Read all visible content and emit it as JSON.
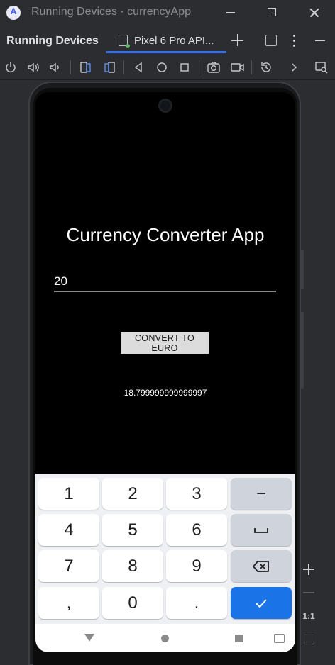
{
  "window": {
    "title": "Running Devices - currencyApp"
  },
  "tool_window": {
    "title": "Running Devices",
    "device_tab": "Pixel 6 Pro API..."
  },
  "toolbar": {
    "icons": [
      "power-icon",
      "volume-up-icon",
      "volume-down-icon",
      "rotate-left-icon",
      "rotate-right-icon",
      "back-icon",
      "home-icon",
      "overview-icon",
      "screenshot-icon",
      "screen-record-icon",
      "reset-icon",
      "chevron-right-icon",
      "device-mirroring-icon"
    ]
  },
  "app": {
    "title": "Currency Converter App",
    "amount_value": "20",
    "convert_label": "CONVERT TO EURO",
    "result": "18.799999999999997"
  },
  "keyboard": {
    "rows": [
      [
        "1",
        "2",
        "3",
        "−"
      ],
      [
        "4",
        "5",
        "6",
        "space"
      ],
      [
        "7",
        "8",
        "9",
        "backspace"
      ],
      [
        ",",
        "0",
        ".",
        "done"
      ]
    ],
    "labels": {
      "k1": "1",
      "k2": "2",
      "k3": "3",
      "kminus": "−",
      "k4": "4",
      "k5": "5",
      "k6": "6",
      "k7": "7",
      "k8": "8",
      "k9": "9",
      "kcomma": ",",
      "k0": "0",
      "kdot": "."
    }
  },
  "zoom": {
    "actual_size_label": "1:1"
  },
  "colors": {
    "accent": "#3574f0",
    "enter_key": "#1b73e8",
    "ide_bg": "#2b2d30",
    "screen_bg": "#000000"
  }
}
